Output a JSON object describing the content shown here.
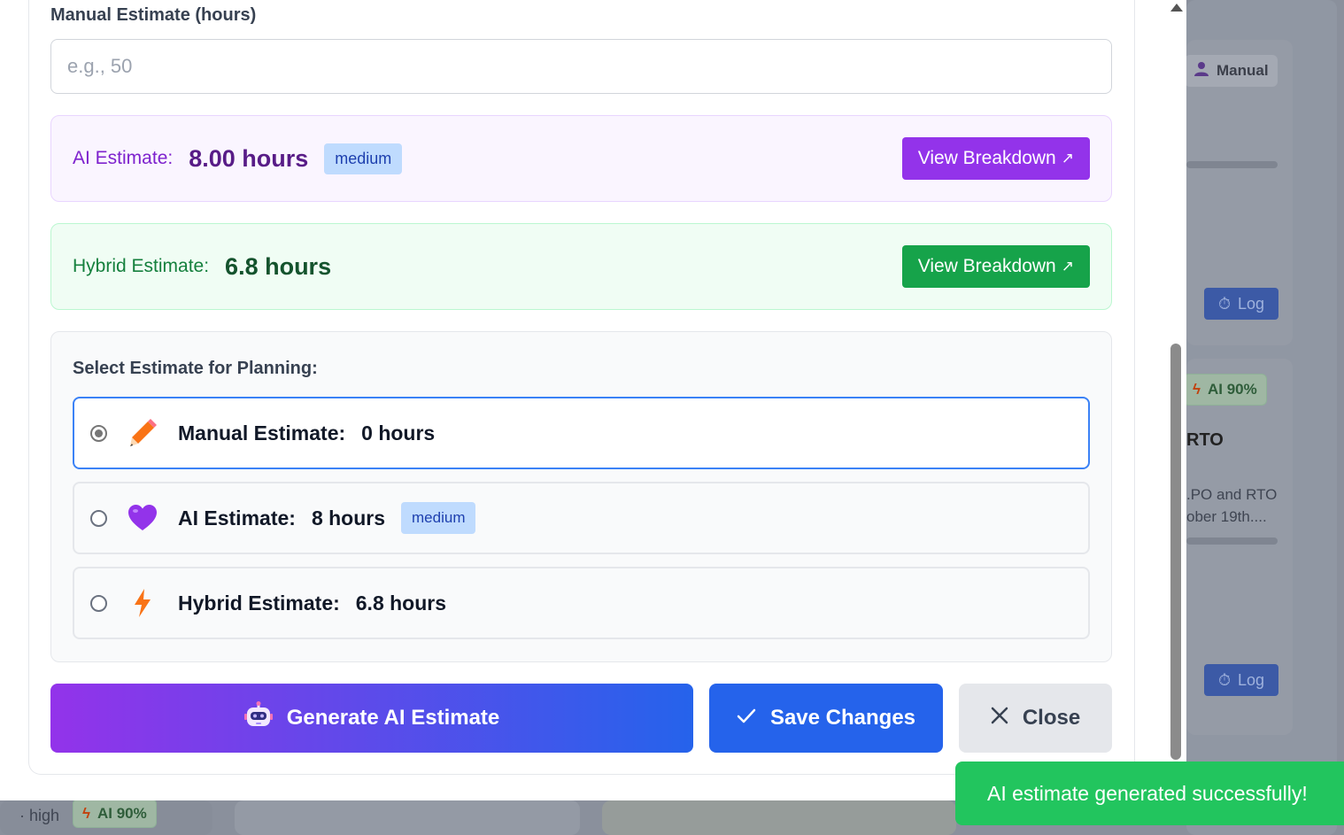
{
  "background": {
    "chip_manual": "Manual",
    "chip_ai_top": "AI 90%",
    "task_title_fragment": "RTO",
    "task_desc_line1": ".PO and RTO",
    "task_desc_line2": "ober 19th....",
    "log_label": "Log",
    "bottom_priority": "· high",
    "chip_ai_bottom": "AI 90%"
  },
  "form": {
    "manual_label": "Manual Estimate (hours)",
    "manual_placeholder": "e.g., 50",
    "manual_value": ""
  },
  "ai_estimate": {
    "label": "AI Estimate:",
    "value": "8.00 hours",
    "confidence": "medium",
    "button": "View Breakdown"
  },
  "hybrid_estimate": {
    "label": "Hybrid Estimate:",
    "value": "6.8 hours",
    "button": "View Breakdown"
  },
  "planning": {
    "title": "Select Estimate for Planning:",
    "options": [
      {
        "label": "Manual Estimate:",
        "value": "0 hours",
        "icon": "pencil-icon",
        "selected": true
      },
      {
        "label": "AI Estimate:",
        "value": "8 hours",
        "icon": "purple-heart-icon",
        "badge": "medium",
        "selected": false
      },
      {
        "label": "Hybrid Estimate:",
        "value": "6.8 hours",
        "icon": "lightning-icon",
        "selected": false
      }
    ]
  },
  "actions": {
    "generate": "Generate AI Estimate",
    "save": "Save Changes",
    "close": "Close"
  },
  "toast": {
    "message": "AI estimate generated successfully!"
  },
  "colors": {
    "ai_purple": "#9333ea",
    "hybrid_green": "#16a34a",
    "primary_blue": "#2563eb",
    "selected_border": "#3b82f6",
    "toast_green": "#22c55e"
  }
}
